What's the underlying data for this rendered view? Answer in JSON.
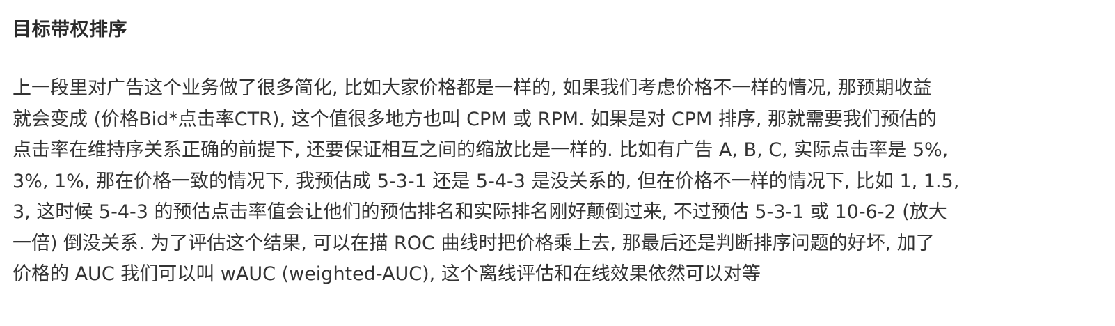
{
  "section": {
    "heading": "目标带权排序",
    "paragraph_lines": [
      "上一段里对广告这个业务做了很多简化, 比如大家价格都是一样的, 如果我们考虑价格不一样的情况, 那预期收益",
      "就会变成 (价格Bid*点击率CTR), 这个值很多地方也叫 CPM 或 RPM. 如果是对 CPM 排序, 那就需要我们预估的",
      "点击率在维持序关系正确的前提下, 还要保证相互之间的缩放比是一样的. 比如有广告 A, B, C, 实际点击率是 5%,",
      "3%, 1%, 那在价格一致的情况下, 我预估成 5-3-1 还是 5-4-3 是没关系的, 但在价格不一样的情况下, 比如 1, 1.5,",
      "3, 这时候 5-4-3 的预估点击率值会让他们的预估排名和实际排名刚好颠倒过来, 不过预估 5-3-1 或 10-6-2 (放大",
      "一倍) 倒没关系. 为了评估这个结果, 可以在描 ROC 曲线时把价格乘上去, 那最后还是判断排序问题的好坏, 加了",
      "价格的 AUC 我们可以叫 wAUC (weighted-AUC), 这个离线评估和在线效果依然可以对等"
    ]
  }
}
